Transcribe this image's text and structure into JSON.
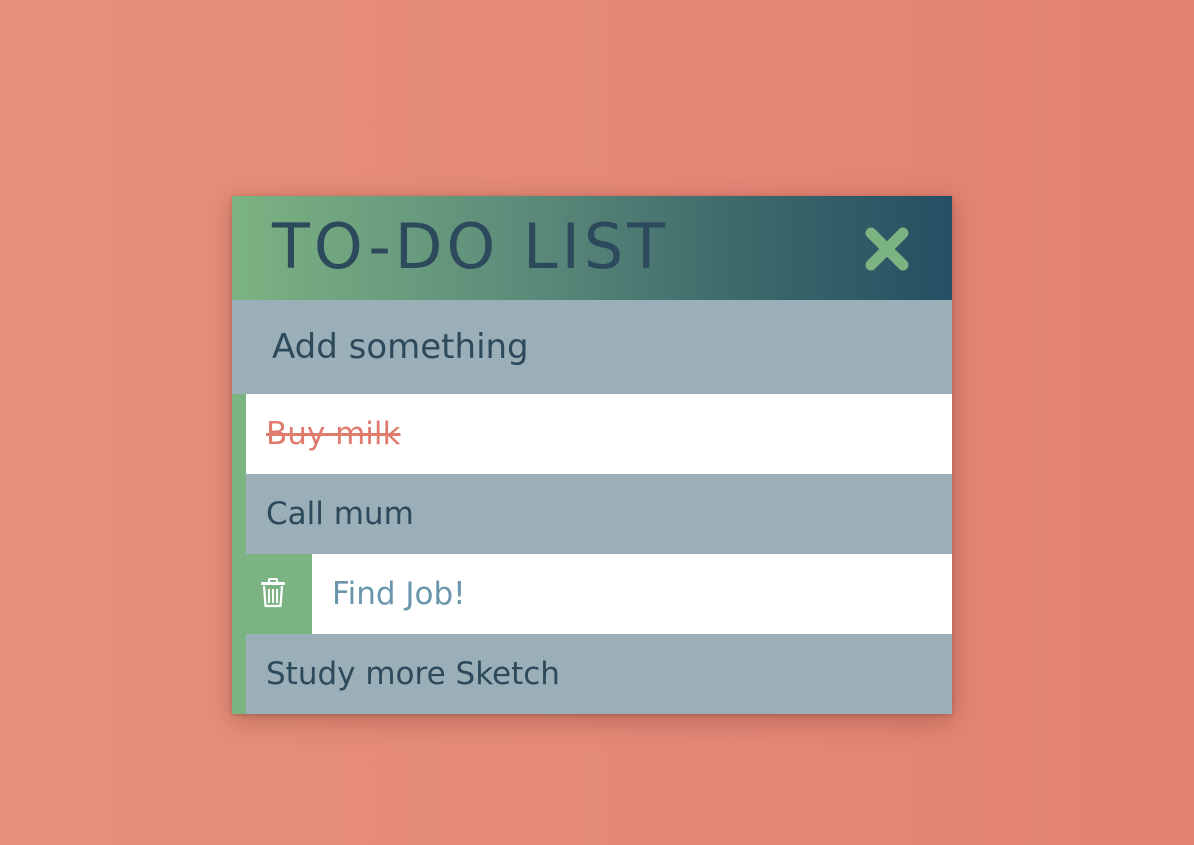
{
  "header": {
    "title": "TO-DO LIST",
    "close_icon": "close-x-icon"
  },
  "add": {
    "placeholder": "Add something"
  },
  "todos": [
    {
      "text": "Buy milk",
      "completed": true
    },
    {
      "text": "Call mum",
      "completed": false
    },
    {
      "text": "Find Job!",
      "completed": false,
      "hovered": true,
      "action_icon": "trash-icon"
    },
    {
      "text": "Study more Sketch",
      "completed": false
    }
  ],
  "colors": {
    "background": "#e48877",
    "header_start": "#7cb382",
    "header_end": "#254f63",
    "title_text": "#2c4a5b",
    "row_grey": "#9aafb7",
    "row_white": "#ffffff",
    "accent_green": "#7cb382",
    "completed_text": "#df7c6e",
    "hover_text": "#6a96ab"
  }
}
